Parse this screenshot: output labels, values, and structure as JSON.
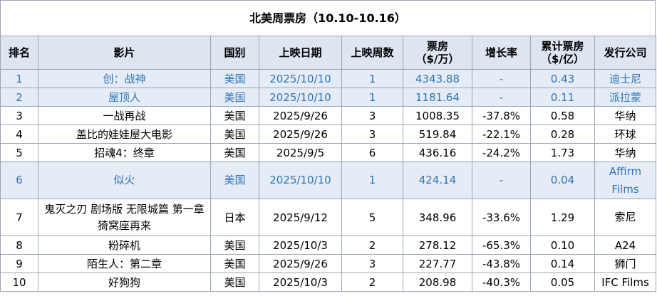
{
  "title": "北美周票房（10.10-10.16）",
  "columns": [
    "排名",
    "影片",
    "国别",
    "上映日期",
    "上映周数",
    "票房\n（$/万）",
    "增长率",
    "累计票房\n（$/亿）",
    "发行公司"
  ],
  "rows": [
    {
      "rank": "1",
      "film": "创：战神",
      "country": "美国",
      "date": "2025/10/10",
      "weeks": "1",
      "gross": "4343.88",
      "growth": "-",
      "total": "0.43",
      "distributor": "迪士尼",
      "highlight": true
    },
    {
      "rank": "2",
      "film": "屋顶人",
      "country": "美国",
      "date": "2025/10/10",
      "weeks": "1",
      "gross": "1181.64",
      "growth": "-",
      "total": "0.11",
      "distributor": "派拉蒙",
      "highlight": true
    },
    {
      "rank": "3",
      "film": "一战再战",
      "country": "美国",
      "date": "2025/9/26",
      "weeks": "3",
      "gross": "1008.35",
      "growth": "-37.8%",
      "total": "0.58",
      "distributor": "华纳",
      "highlight": false
    },
    {
      "rank": "4",
      "film": "盖比的娃娃屋大电影",
      "country": "美国",
      "date": "2025/9/26",
      "weeks": "3",
      "gross": "519.84",
      "growth": "-22.1%",
      "total": "0.28",
      "distributor": "环球",
      "highlight": false
    },
    {
      "rank": "5",
      "film": "招魂4：终章",
      "country": "美国",
      "date": "2025/9/5",
      "weeks": "6",
      "gross": "436.16",
      "growth": "-24.2%",
      "total": "1.73",
      "distributor": "华纳",
      "highlight": false
    },
    {
      "rank": "6",
      "film": "似火",
      "country": "美国",
      "date": "2025/10/10",
      "weeks": "1",
      "gross": "424.14",
      "growth": "-",
      "total": "0.04",
      "distributor": "Affirm Films",
      "highlight": true,
      "tall": true
    },
    {
      "rank": "7",
      "film": "鬼灭之刃 剧场版 无限城篇 第一章 猗窝座再来",
      "country": "日本",
      "date": "2025/9/12",
      "weeks": "5",
      "gross": "348.96",
      "growth": "-33.6%",
      "total": "1.29",
      "distributor": "索尼",
      "highlight": false,
      "tall": true
    },
    {
      "rank": "8",
      "film": "粉碎机",
      "country": "美国",
      "date": "2025/10/3",
      "weeks": "2",
      "gross": "278.12",
      "growth": "-65.3%",
      "total": "0.10",
      "distributor": "A24",
      "highlight": false
    },
    {
      "rank": "9",
      "film": "陌生人：第二章",
      "country": "美国",
      "date": "2025/9/26",
      "weeks": "3",
      "gross": "227.77",
      "growth": "-43.8%",
      "total": "0.14",
      "distributor": "狮门",
      "highlight": false
    },
    {
      "rank": "10",
      "film": "好狗狗",
      "country": "美国",
      "date": "2025/10/3",
      "weeks": "2",
      "gross": "208.98",
      "growth": "-40.3%",
      "total": "0.05",
      "distributor": "IFC Films",
      "highlight": false
    }
  ]
}
